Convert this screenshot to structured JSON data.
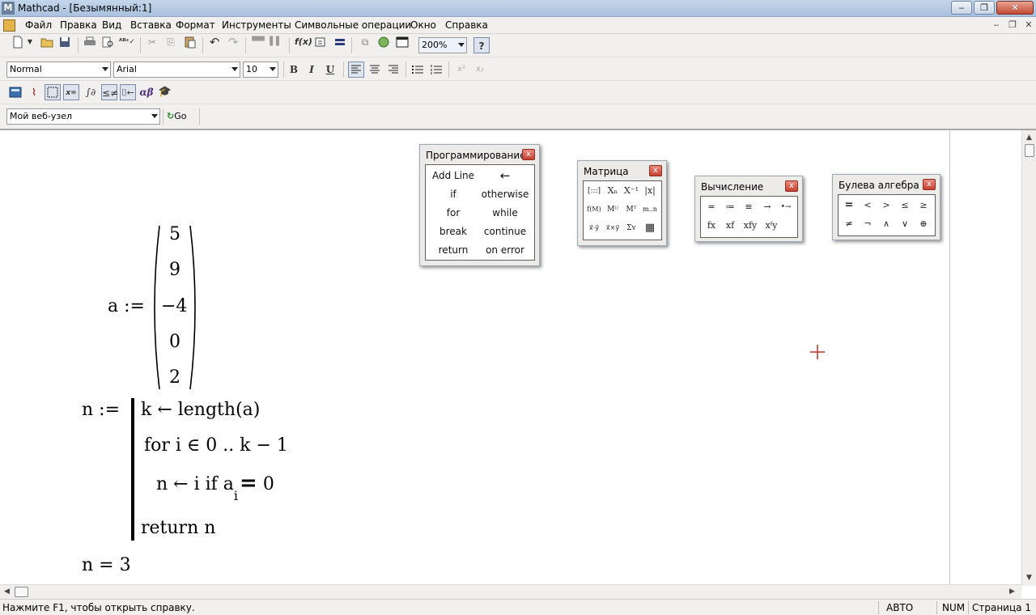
{
  "window": {
    "title": "Mathcad - [Безымянный:1]",
    "app_icon": "M",
    "controls": [
      "‒",
      "❐",
      "✕"
    ]
  },
  "menu": {
    "items": [
      "Файл",
      "Правка",
      "Вид",
      "Вставка",
      "Формат",
      "Инструменты",
      "Символьные операции",
      "Окно",
      "Справка"
    ],
    "mdi": [
      "‒",
      "❐",
      "✕"
    ]
  },
  "toolbar": {
    "zoom": "200%",
    "help_glyph": "?",
    "fx_label": "f(x)",
    "icons": {
      "new": "new-document-icon",
      "open": "open-folder-icon",
      "save": "save-disk-icon",
      "print": "printer-icon",
      "preview": "print-preview-icon",
      "spell": "spell-check-icon",
      "cut": "cut-icon",
      "copy": "copy-icon",
      "paste": "paste-icon",
      "undo": "undo-icon",
      "redo": "redo-icon"
    }
  },
  "format": {
    "style": "Normal",
    "font": "Arial",
    "size": "10",
    "bold": "B",
    "italic": "I",
    "underline": "U",
    "superscript": "x²",
    "subscript": "x₂"
  },
  "math_toolbar": {
    "greek": "αβ",
    "eval": "x="
  },
  "web": {
    "address": "Мой веб-узел",
    "go": "Go"
  },
  "document": {
    "a_label": "a :=",
    "vector": [
      "5",
      "9",
      "−4",
      "0",
      "2"
    ],
    "n_label": "n :=",
    "prog": {
      "line1": "k ← length(a)",
      "line2": "for  i ∈ 0 .. k − 1",
      "line3a": "n ← i   if  a",
      "line3sub": "i",
      "line3b": " 0",
      "line3eq": "=",
      "line4": "return  n"
    },
    "result": "n = 3"
  },
  "palettes": {
    "programming": {
      "title": "Программирование",
      "close": "x",
      "buttons": [
        [
          "Add Line",
          "←"
        ],
        [
          "if",
          "otherwise"
        ],
        [
          "for",
          "while"
        ],
        [
          "break",
          "continue"
        ],
        [
          "return",
          "on error"
        ]
      ]
    },
    "matrix": {
      "title": "Матрица",
      "close": "x",
      "buttons": [
        "[:::]",
        "Xₙ",
        "X⁻¹",
        "|x|",
        "f(M)",
        "M⁽⁾",
        "Mᵀ",
        "m..n",
        "x⃗·y⃗",
        "x⃗×y⃗",
        "Σv",
        "▦"
      ]
    },
    "evaluation": {
      "title": "Вычисление",
      "close": "x",
      "buttons": [
        "=",
        "≔",
        "≡",
        "→",
        "•→",
        "fx",
        "xf",
        "xfy",
        "xᶠy"
      ]
    },
    "boolean": {
      "title": "Булева алгебра",
      "close": "x",
      "buttons": [
        "=",
        "<",
        ">",
        "≤",
        "≥",
        "≠",
        "¬",
        "∧",
        "∨",
        "⊕"
      ]
    }
  },
  "status": {
    "help": "Нажмите F1, чтобы открыть справку.",
    "mode": "АВТО",
    "num": "NUM",
    "page": "Страница 1"
  }
}
